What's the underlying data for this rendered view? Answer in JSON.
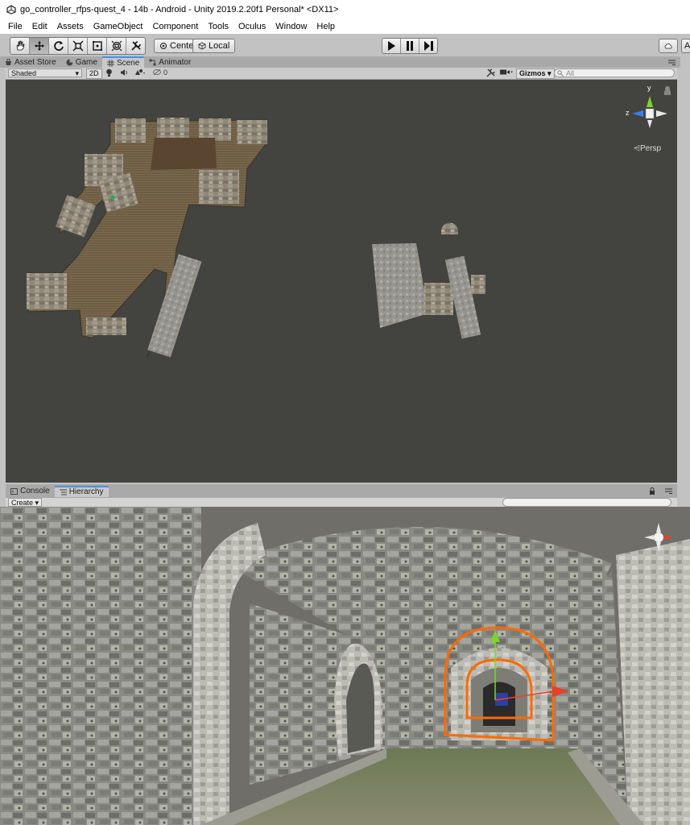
{
  "window": {
    "title": "go_controller_rfps-quest_4 - 14b - Android - Unity 2019.2.20f1 Personal* <DX11>"
  },
  "menu": [
    "File",
    "Edit",
    "Assets",
    "GameObject",
    "Component",
    "Tools",
    "Oculus",
    "Window",
    "Help"
  ],
  "toolbar": {
    "tools": [
      "hand",
      "move",
      "rotate",
      "scale",
      "rect",
      "transform",
      "custom"
    ],
    "pivot_label": "Center",
    "space_label": "Local",
    "playback": [
      "play",
      "pause",
      "step"
    ]
  },
  "tabs": [
    "Asset Store",
    "Game",
    "Scene",
    "Animator"
  ],
  "active_tab": "Scene",
  "scene_toolbar": {
    "shading_mode": "Shaded",
    "mode_2d": "2D",
    "fx_count": "0",
    "gizmos_label": "Gizmos",
    "search_placeholder": "All"
  },
  "scene_gizmo": {
    "y_label": "y",
    "z_label": "z",
    "projection_label": "Persp"
  },
  "bottom_tabs": [
    "Console",
    "Hierarchy"
  ],
  "hierarchy": {
    "create_label": "Create"
  },
  "colors": {
    "scene_bg": "#434340",
    "tab_accent": "#4a8ee0",
    "selection_outline": "#ff6a00",
    "gizmo_y": "#7bd62b",
    "gizmo_x": "#e8402c",
    "gizmo_z": "#3b7ee8"
  }
}
